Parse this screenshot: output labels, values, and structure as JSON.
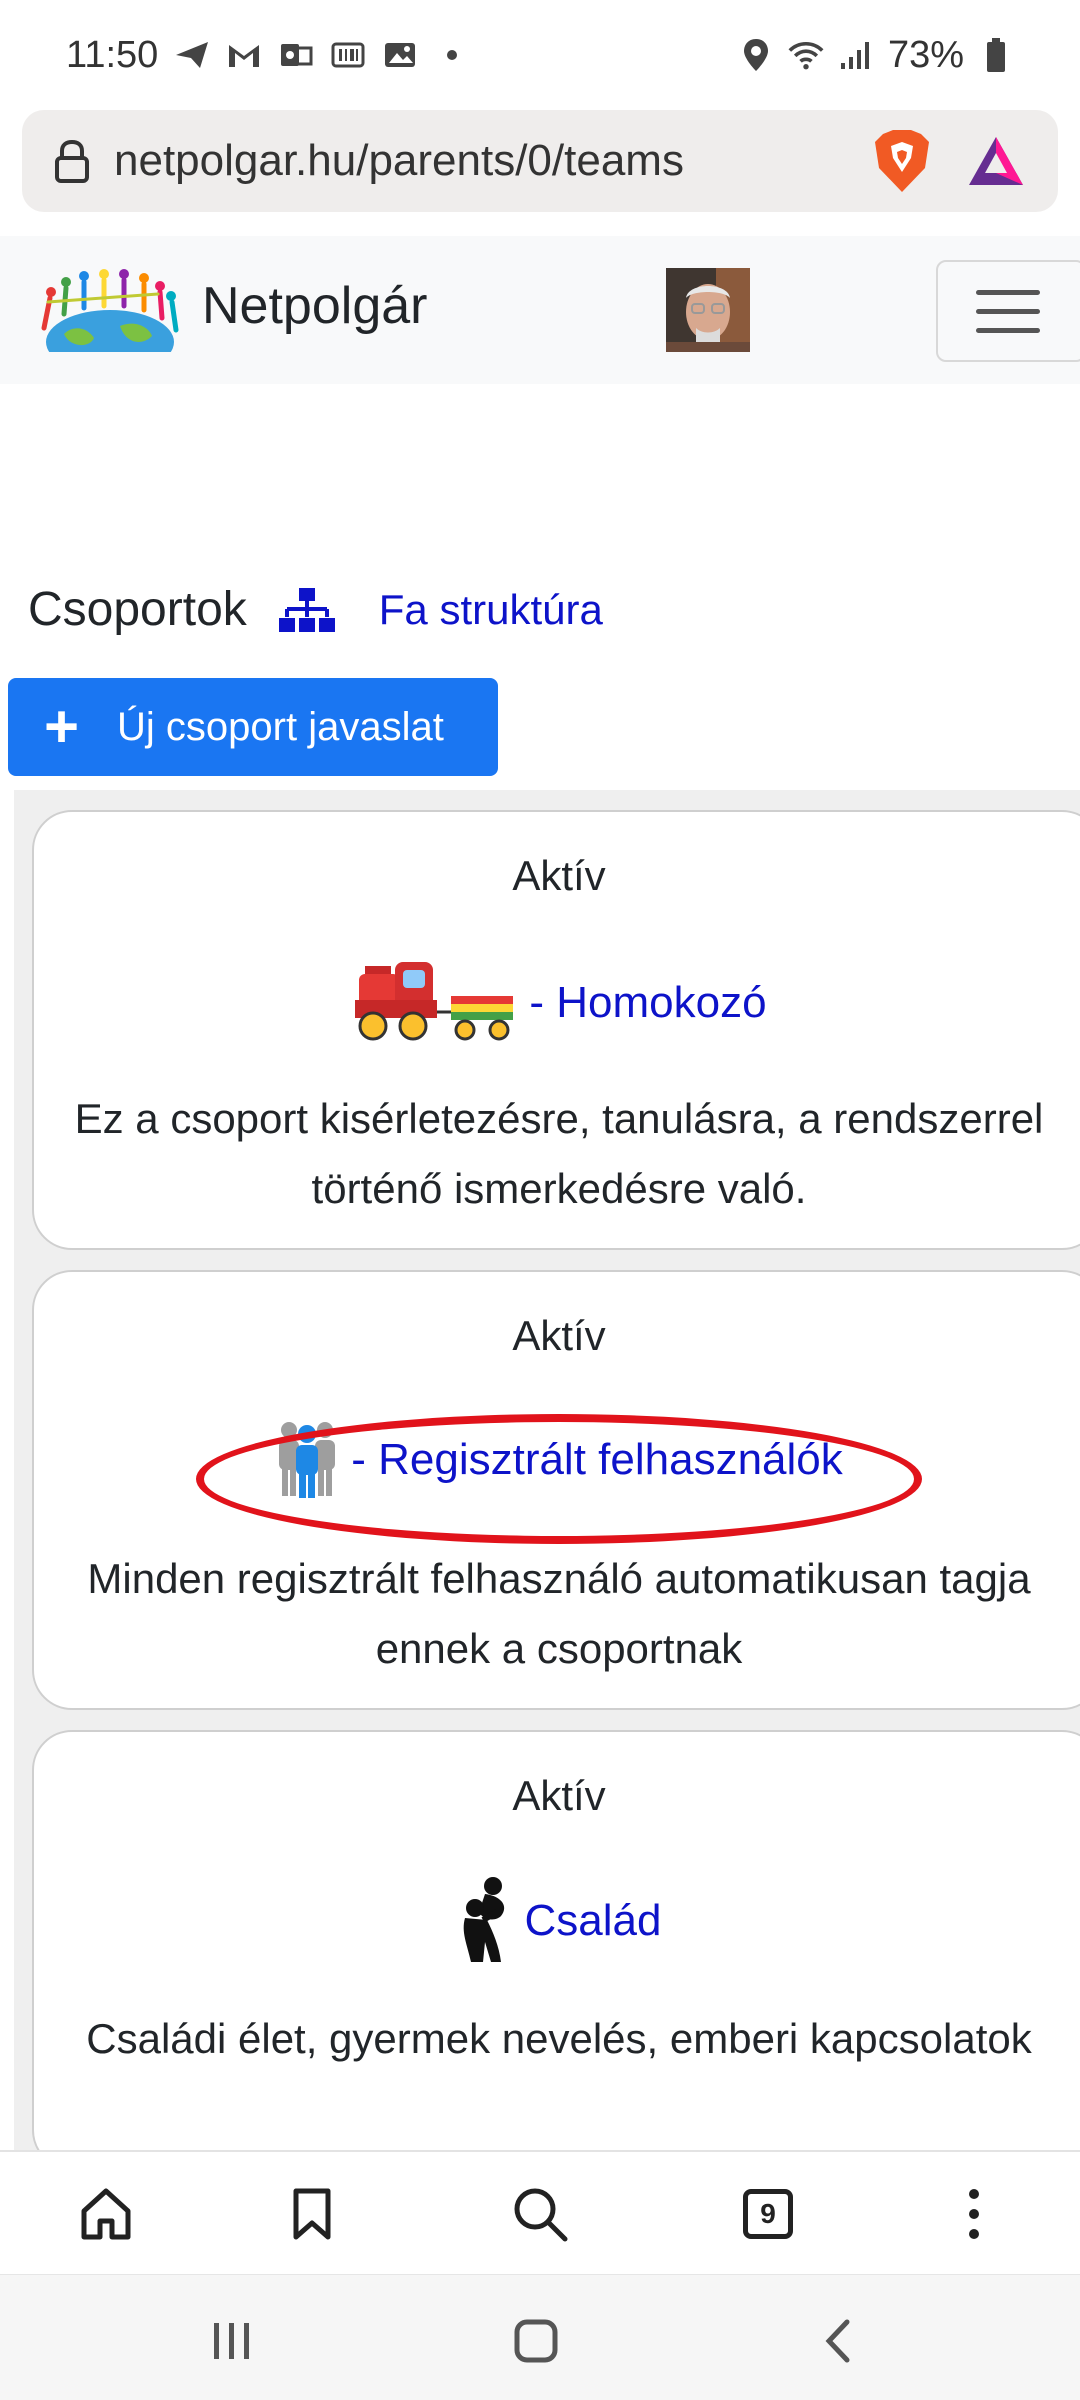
{
  "status_bar": {
    "time": "11:50",
    "battery": "73%"
  },
  "browser": {
    "url": "netpolgar.hu/parents/0/teams",
    "tab_count": "9"
  },
  "site": {
    "brand": "Netpolgár"
  },
  "page": {
    "title": "Csoportok",
    "tree_link": "Fa struktúra",
    "new_group_button": "Új csoport javaslat"
  },
  "groups": [
    {
      "status": "Aktív",
      "title": "- Homokozó",
      "icon": "toy-train-icon",
      "description": "Ez a csoport kisérletezésre, tanulásra, a rendszerrel történő ismerkedésre való."
    },
    {
      "status": "Aktív",
      "title": "- Regisztrált felhasználók",
      "icon": "people-group-icon",
      "description": "Minden regisztrált felhasználó automatikusan tagja ennek a csoportnak"
    },
    {
      "status": "Aktív",
      "title": "Család",
      "icon": "parent-child-icon",
      "description": "Családi élet, gyermek nevelés, emberi kapcsolatok"
    }
  ],
  "colors": {
    "link": "#0d13c9",
    "primary_button": "#1a76f2",
    "annotation": "#e1131b"
  }
}
